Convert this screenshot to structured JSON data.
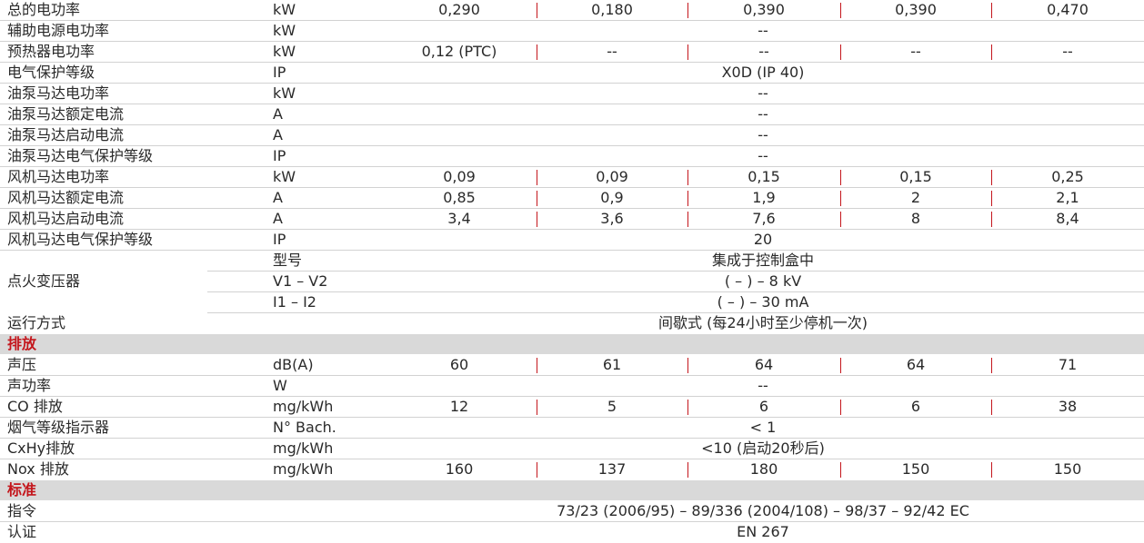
{
  "electrical": [
    {
      "name": "总的电功率",
      "unit": "kW",
      "values": [
        "0,290",
        "0,180",
        "0,390",
        "0,390",
        "0,470"
      ]
    },
    {
      "name": "辅助电源电功率",
      "unit": "kW",
      "span": "--"
    },
    {
      "name": "预热器电功率",
      "unit": "kW",
      "values": [
        "0,12 (PTC)",
        "--",
        "--",
        "--",
        "--"
      ]
    },
    {
      "name": "电气保护等级",
      "unit": "IP",
      "span": "X0D (IP 40)"
    },
    {
      "name": "油泵马达电功率",
      "unit": "kW",
      "span": "--"
    },
    {
      "name": "油泵马达额定电流",
      "unit": "A",
      "span": "--"
    },
    {
      "name": "油泵马达启动电流",
      "unit": "A",
      "span": "--"
    },
    {
      "name": "油泵马达电气保护等级",
      "unit": "IP",
      "span": "--"
    },
    {
      "name": "风机马达电功率",
      "unit": "kW",
      "values": [
        "0,09",
        "0,09",
        "0,15",
        "0,15",
        "0,25"
      ]
    },
    {
      "name": "风机马达额定电流",
      "unit": "A",
      "values": [
        "0,85",
        "0,9",
        "1,9",
        "2",
        "2,1"
      ]
    },
    {
      "name": "风机马达启动电流",
      "unit": "A",
      "values": [
        "3,4",
        "3,6",
        "7,6",
        "8",
        "8,4"
      ]
    },
    {
      "name": "风机马达电气保护等级",
      "unit": "IP",
      "span": "20"
    }
  ],
  "ignition": {
    "name": "点火变压器",
    "rows": [
      {
        "sub": "型号",
        "value": "集成于控制盒中"
      },
      {
        "sub": "V1 – V2",
        "value": "( – ) – 8 kV"
      },
      {
        "sub": "I1 – I2",
        "value": "( – ) – 30 mA"
      }
    ]
  },
  "operation": {
    "name": "运行方式",
    "span": "间歇式 (每24小时至少停机一次)"
  },
  "emissions_title": "排放",
  "emissions": [
    {
      "name": "声压",
      "unit": "dB(A)",
      "values": [
        "60",
        "61",
        "64",
        "64",
        "71"
      ]
    },
    {
      "name": "声功率",
      "unit": "W",
      "span": "--"
    },
    {
      "name": "CO 排放",
      "unit": "mg/kWh",
      "values": [
        "12",
        "5",
        "6",
        "6",
        "38"
      ]
    },
    {
      "name": "烟气等级指示器",
      "unit": "N°   Bach.",
      "span": "< 1"
    },
    {
      "name": "CxHy排放",
      "unit": "mg/kWh",
      "span": "<10 (启动20秒后)"
    },
    {
      "name": "Nox 排放",
      "unit": "mg/kWh",
      "values": [
        "160",
        "137",
        "180",
        "150",
        "150"
      ]
    }
  ],
  "standards_title": "标准",
  "standards": [
    {
      "name": "指令",
      "span": "73/23 (2006/95) – 89/336 (2004/108) – 98/37 – 92/42 EC"
    },
    {
      "name": "认证",
      "span": "EN 267"
    }
  ],
  "colors": {
    "accent_red": "#c4161c",
    "section_band": "#d9d9d9",
    "rule": "#d2d2d2"
  }
}
